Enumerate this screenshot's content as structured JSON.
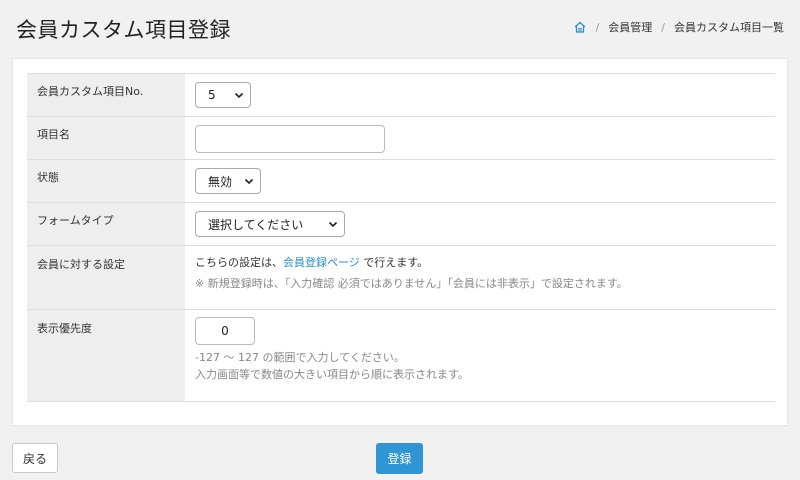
{
  "header": {
    "title": "会員カスタム項目登録",
    "breadcrumb": [
      "会員管理",
      "会員カスタム項目一覧"
    ]
  },
  "form": {
    "custom_no": {
      "label": "会員カスタム項目No.",
      "value": "5"
    },
    "item_name": {
      "label": "項目名",
      "value": ""
    },
    "status": {
      "label": "状態",
      "value": "無効"
    },
    "form_type": {
      "label": "フォームタイプ",
      "value": "選択してください"
    },
    "member_setting": {
      "label": "会員に対する設定",
      "text_before": "こちらの設定は、",
      "link": "会員登録ページ",
      "text_after": " で行えます。",
      "note": "※ 新規登録時は、「入力確認 必須ではありません」「会員には非表示」で設定されます。"
    },
    "priority": {
      "label": "表示優先度",
      "value": "0",
      "note1": "-127 ～ 127 の範囲で入力してください。",
      "note2": "入力画面等で数値の大きい項目から順に表示されます。"
    }
  },
  "buttons": {
    "back": "戻る",
    "submit": "登録"
  },
  "colors": {
    "primary": "#2f95d4",
    "link": "#2a8fd0",
    "label_bg": "#eeeeee"
  }
}
